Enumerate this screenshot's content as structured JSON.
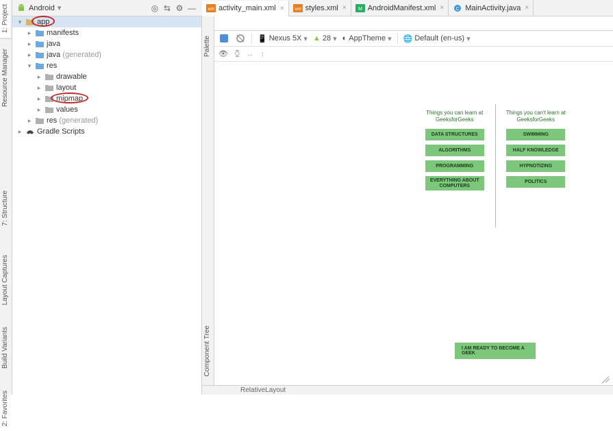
{
  "sidebars": {
    "left": [
      "1: Project",
      "Resource Manager",
      "7: Structure",
      "Layout Captures",
      "Build Variants",
      "2: Favorites"
    ]
  },
  "project": {
    "title": "Android",
    "tree": [
      {
        "d": 0,
        "chev": "▾",
        "icon": "app-folder",
        "label": "app",
        "gen": "",
        "sel": true,
        "circ": true
      },
      {
        "d": 1,
        "chev": "▸",
        "icon": "folder",
        "label": "manifests",
        "gen": ""
      },
      {
        "d": 1,
        "chev": "▸",
        "icon": "folder",
        "label": "java",
        "gen": ""
      },
      {
        "d": 1,
        "chev": "▸",
        "icon": "folder",
        "label": "java",
        "gen": "(generated)"
      },
      {
        "d": 1,
        "chev": "▾",
        "icon": "folder",
        "label": "res",
        "gen": ""
      },
      {
        "d": 2,
        "chev": "▸",
        "icon": "folder-g",
        "label": "drawable",
        "gen": ""
      },
      {
        "d": 2,
        "chev": "▸",
        "icon": "folder-g",
        "label": "layout",
        "gen": ""
      },
      {
        "d": 2,
        "chev": "▸",
        "icon": "folder-g",
        "label": "mipmap",
        "gen": "",
        "circ": true
      },
      {
        "d": 2,
        "chev": "▸",
        "icon": "folder-g",
        "label": "values",
        "gen": ""
      },
      {
        "d": 1,
        "chev": "▸",
        "icon": "folder-g",
        "label": "res",
        "gen": "(generated)"
      },
      {
        "d": 0,
        "chev": "▸",
        "icon": "gradle",
        "label": "Gradle Scripts",
        "gen": ""
      }
    ]
  },
  "tabs": [
    {
      "icon": "xml",
      "label": "activity_main.xml",
      "active": true
    },
    {
      "icon": "xml",
      "label": "styles.xml"
    },
    {
      "icon": "mf",
      "label": "AndroidManifest.xml"
    },
    {
      "icon": "java",
      "label": "MainActivity.java"
    }
  ],
  "designer": {
    "sideTabs": [
      "Palette",
      "Component Tree"
    ],
    "toolbar": {
      "device": "Nexus 5X",
      "api": "28",
      "theme": "AppTheme",
      "locale": "Default (en-us)"
    },
    "status": "RelativeLayout"
  },
  "phone": {
    "left": {
      "heading": "Things you can learn at GeeksforGeeks",
      "buttons": [
        "DATA STRUCTURES",
        "ALGORITHMS",
        "PROGRAMMING",
        "EVERYTHING ABOUT COMPUTERS"
      ]
    },
    "right": {
      "heading": "Things you can't learn at GeeksforGeeks",
      "buttons": [
        "SWIMMING",
        "HALF KNOWLEDGE",
        "HYPNOTIZING",
        "POLITICS"
      ]
    },
    "cta": "I AM READY TO BECOME A GEEK"
  }
}
